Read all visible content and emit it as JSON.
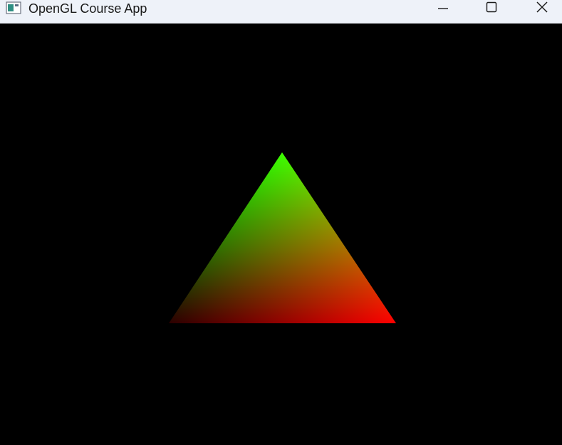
{
  "window": {
    "title": "OpenGL Course App",
    "icon": "window-app-icon",
    "controls": {
      "minimize": "minimize-icon",
      "maximize": "maximize-icon",
      "close": "close-icon"
    }
  },
  "scene": {
    "background": "#000000",
    "triangle": {
      "vertex_colors": {
        "top": "#00ff00",
        "bottom_left": "#000000",
        "bottom_right": "#ff0000"
      }
    }
  }
}
